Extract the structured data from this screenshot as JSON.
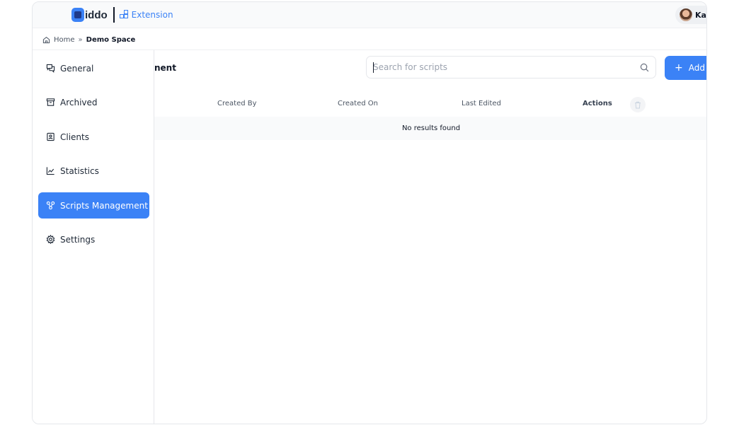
{
  "header": {
    "logo_text": "iddo",
    "extension_label": "Extension",
    "user_name": "Ka"
  },
  "breadcrumb": {
    "home": "Home",
    "separator": "»",
    "current": "Demo Space"
  },
  "sidebar": {
    "items": [
      {
        "label": "General",
        "icon": "chat-bubbles-icon"
      },
      {
        "label": "Archived",
        "icon": "archive-box-icon"
      },
      {
        "label": "Clients",
        "icon": "contact-card-icon"
      },
      {
        "label": "Statistics",
        "icon": "line-chart-icon"
      },
      {
        "label": "Scripts Management",
        "icon": "nodes-icon",
        "active": true
      },
      {
        "label": "Settings",
        "icon": "gear-icon"
      }
    ]
  },
  "main": {
    "title_fragment": "nent",
    "search_placeholder": "Search for scripts",
    "add_button": "Add N",
    "table": {
      "partial_first_column": "",
      "columns": [
        "Created By",
        "Created On",
        "Last Edited",
        "Actions"
      ],
      "empty_text": "No results found"
    }
  },
  "colors": {
    "accent": "#3b82f6",
    "header_bg": "#f9fafb"
  }
}
